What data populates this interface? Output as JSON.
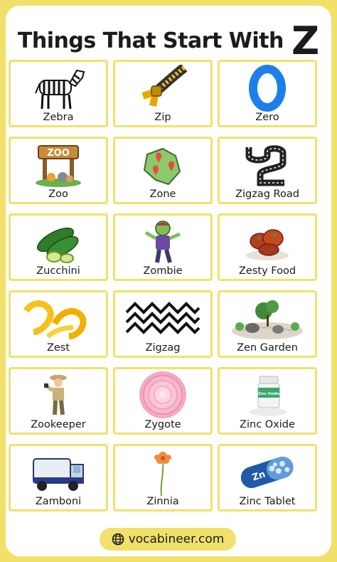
{
  "title": {
    "text": "Things That Start With",
    "letter": "Z"
  },
  "items": [
    {
      "label": "Zebra"
    },
    {
      "label": "Zip"
    },
    {
      "label": "Zero"
    },
    {
      "label": "Zoo",
      "sign_text": "ZOO"
    },
    {
      "label": "Zone"
    },
    {
      "label": "Zigzag Road"
    },
    {
      "label": "Zucchini"
    },
    {
      "label": "Zombie"
    },
    {
      "label": "Zesty Food"
    },
    {
      "label": "Zest"
    },
    {
      "label": "Zigzag"
    },
    {
      "label": "Zen Garden"
    },
    {
      "label": "Zookeeper"
    },
    {
      "label": "Zygote"
    },
    {
      "label": "Zinc Oxide",
      "jar_text": "Zinc Oxide"
    },
    {
      "label": "Zamboni"
    },
    {
      "label": "Zinnia"
    },
    {
      "label": "Zinc Tablet",
      "pill_text": "Zn"
    }
  ],
  "footer": {
    "text": "vocabineer.com",
    "icon": "globe-icon"
  },
  "colors": {
    "frame": "#f1e16b",
    "card": "#ffffff",
    "text": "#1a1a1a",
    "zero_blue": "#1f7fe8"
  }
}
